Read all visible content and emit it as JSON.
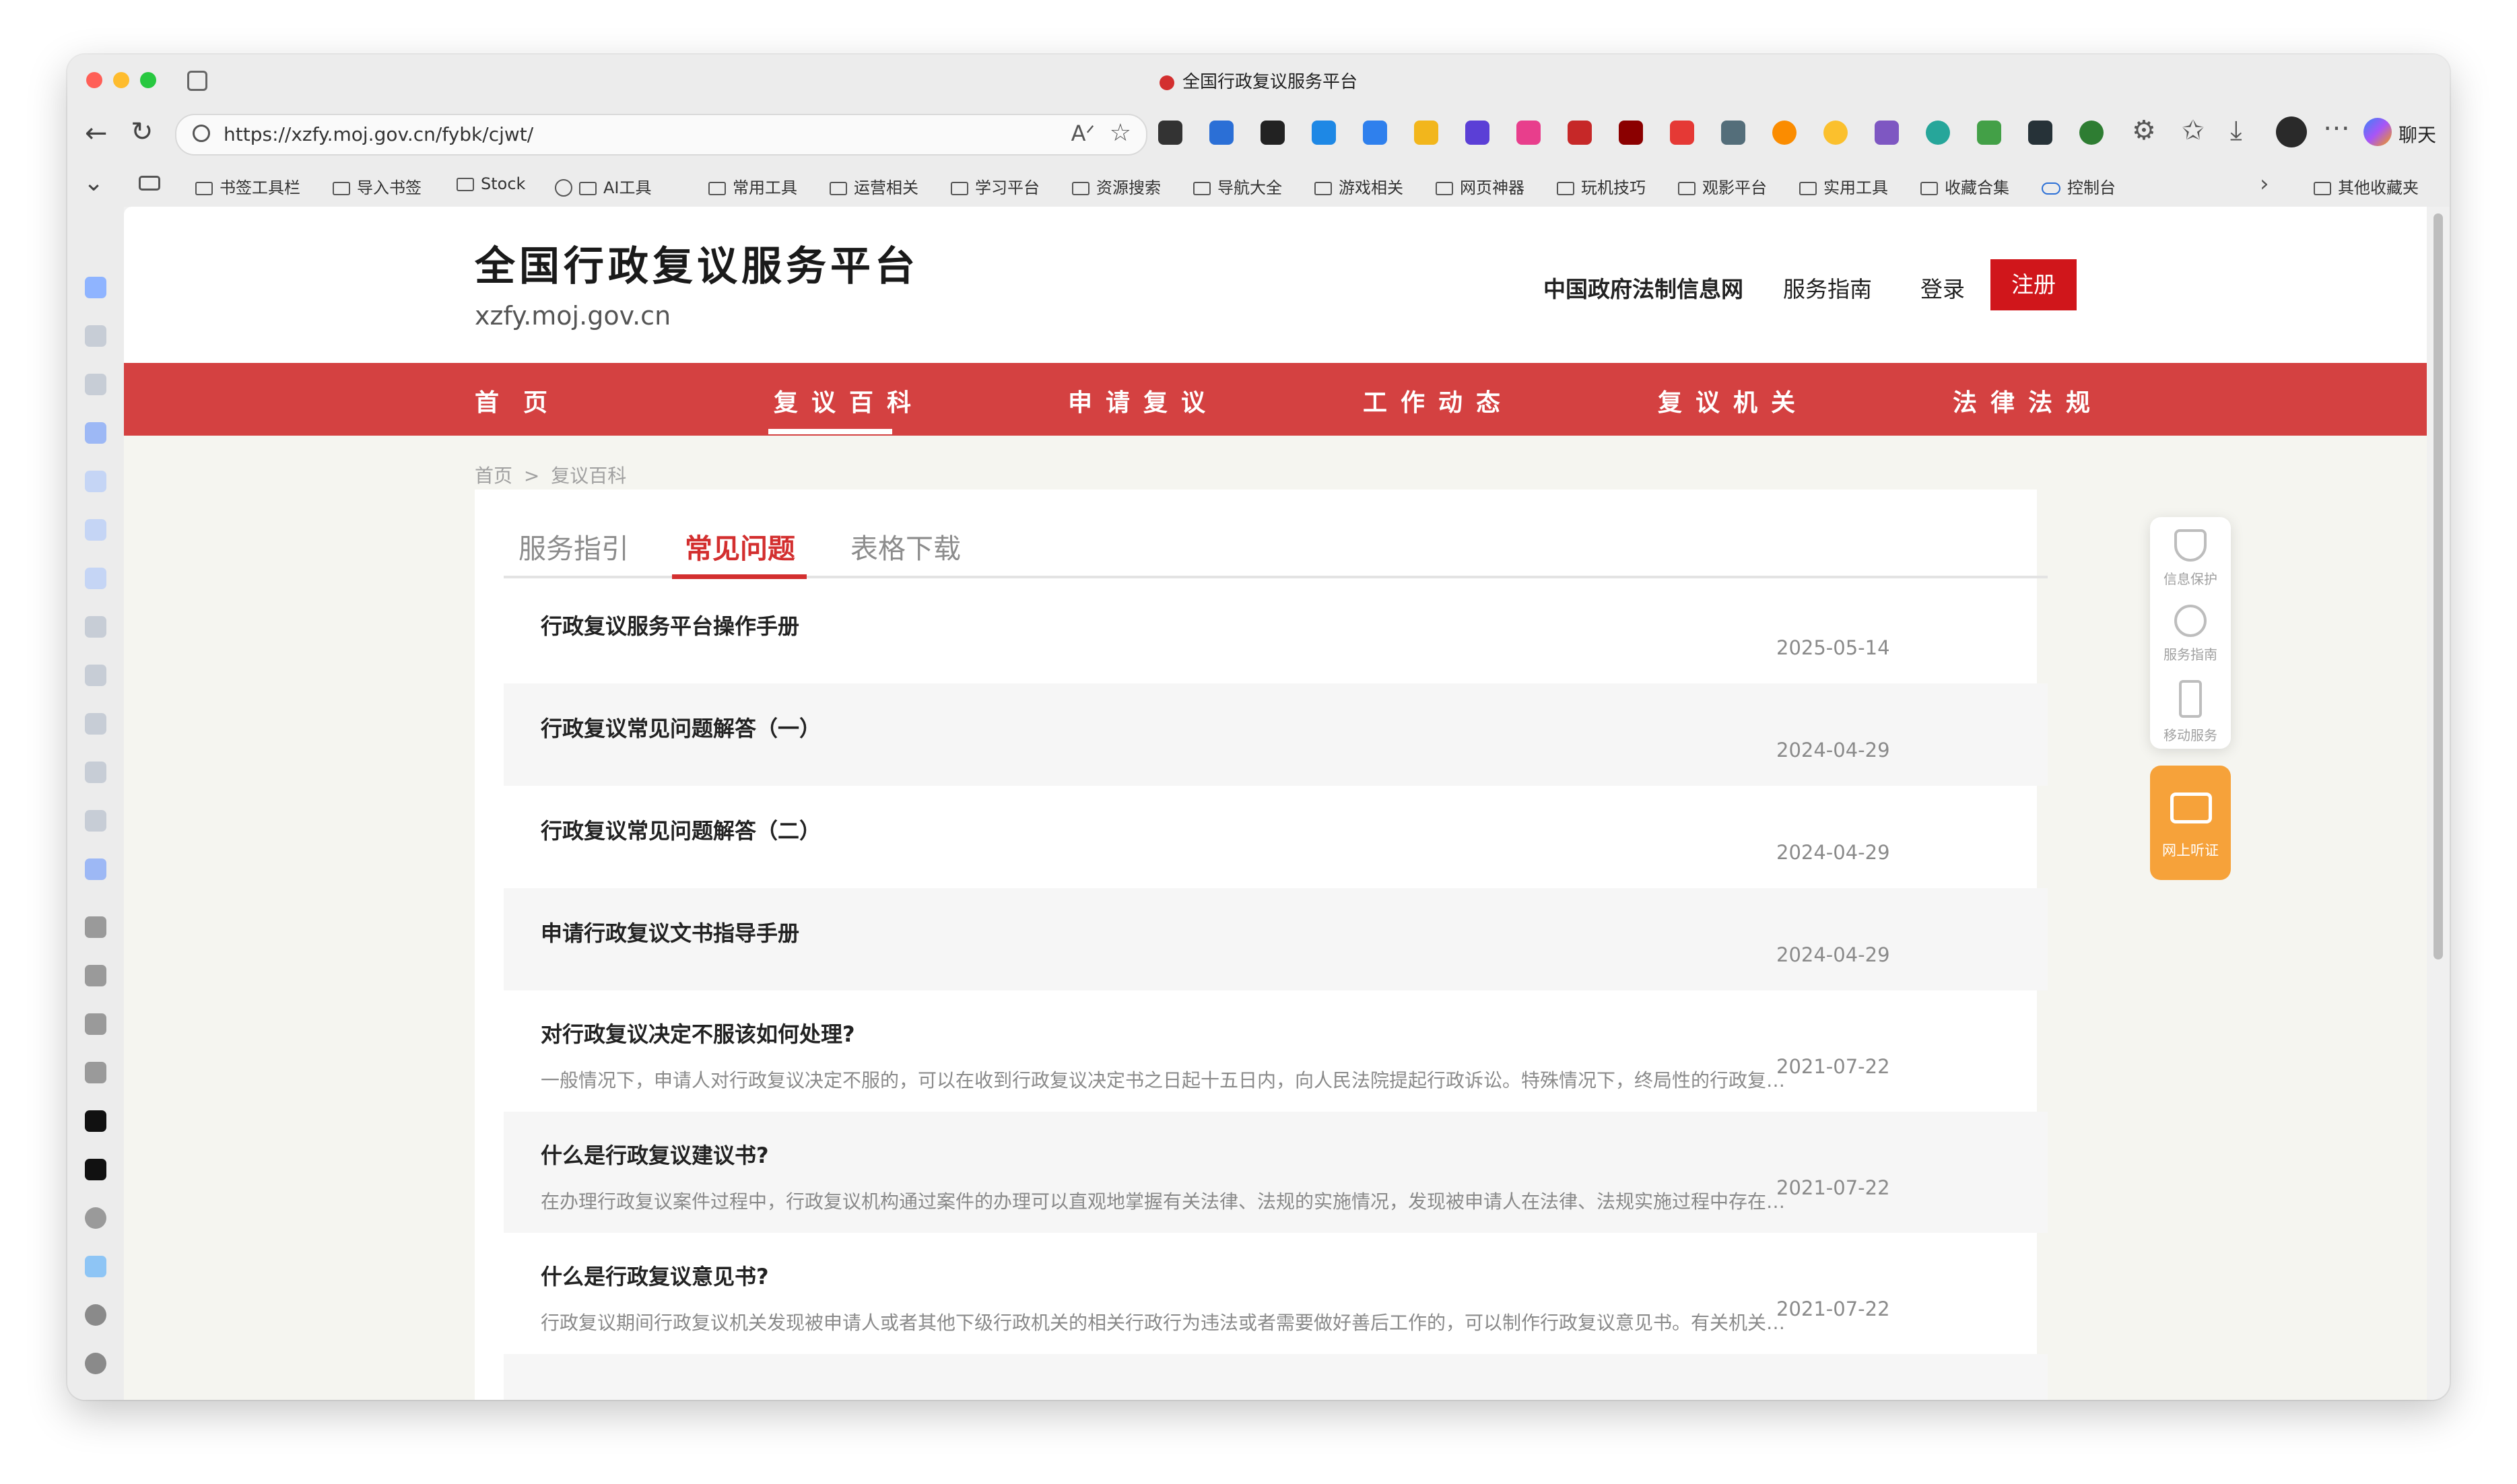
{
  "browser": {
    "tab_title": "全国行政复议服务平台",
    "url": "https://xzfy.moj.gov.cn/fybk/cjwt/",
    "chat_label": "聊天",
    "bookmarks": [
      "书签工具栏",
      "导入书签",
      "Stock",
      "AI工具",
      "常用工具",
      "运营相关",
      "学习平台",
      "资源搜索",
      "导航大全",
      "游戏相关",
      "网页神器",
      "玩机技巧",
      "观影平台",
      "实用工具",
      "收藏合集",
      "控制台"
    ],
    "other_bookmarks": "其他收藏夹"
  },
  "site": {
    "title": "全国行政复议服务平台",
    "domain": "xzfy.moj.gov.cn",
    "top_links": [
      "中国政府法制信息网",
      "服务指南",
      "登录"
    ],
    "register": "注册",
    "nav": [
      "首　页",
      "复议百科",
      "申请复议",
      "工作动态",
      "复议机关",
      "法律法规"
    ],
    "active_nav": "复议百科",
    "accent": "#d44141"
  },
  "breadcrumb": {
    "home": "首页",
    "sep": ">",
    "current": "复议百科"
  },
  "tabs": [
    "服务指引",
    "常见问题",
    "表格下载"
  ],
  "active_tab": "常见问题",
  "items": [
    {
      "title": "行政复议服务平台操作手册",
      "date": "2025-05-14",
      "summary": ""
    },
    {
      "title": "行政复议常见问题解答（一）",
      "date": "2024-04-29",
      "summary": ""
    },
    {
      "title": "行政复议常见问题解答（二）",
      "date": "2024-04-29",
      "summary": ""
    },
    {
      "title": "申请行政复议文书指导手册",
      "date": "2024-04-29",
      "summary": ""
    },
    {
      "title": "对行政复议决定不服该如何处理?",
      "date": "2021-07-22",
      "summary": "一般情况下，申请人对行政复议决定不服的，可以在收到行政复议决定书之日起十五日内，向人民法院提起行政诉讼。特殊情况下，终局性的行政复…"
    },
    {
      "title": "什么是行政复议建议书?",
      "date": "2021-07-22",
      "summary": "在办理行政复议案件过程中，行政复议机构通过案件的办理可以直观地掌握有关法律、法规的实施情况，发现被申请人在法律、法规实施过程中存在…"
    },
    {
      "title": "什么是行政复议意见书?",
      "date": "2021-07-22",
      "summary": "行政复议期间行政复议机关发现被申请人或者其他下级行政机关的相关行政行为违法或者需要做好善后工作的，可以制作行政复议意见书。有关机关…"
    }
  ],
  "float_panel": [
    "信息保护",
    "服务指南",
    "移动服务"
  ],
  "live_button": "网上听证"
}
